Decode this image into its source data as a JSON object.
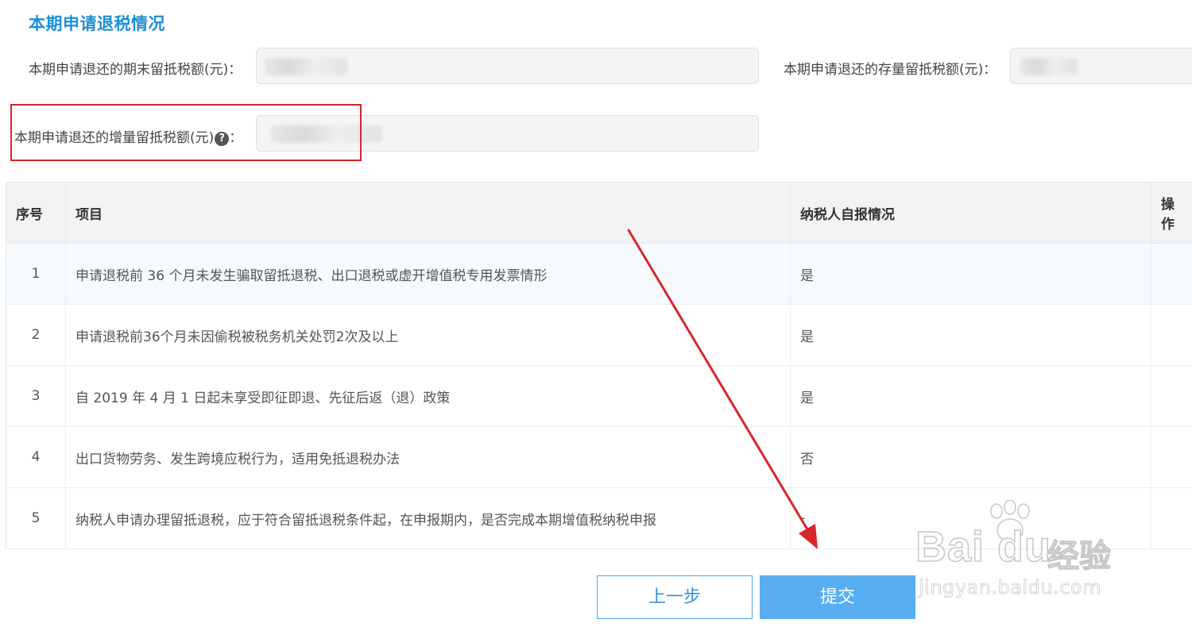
{
  "section": {
    "title": "本期申请退税情况"
  },
  "fields": {
    "period_end_label": "本期申请退还的期末留抵税额(元)：",
    "stock_label": "本期申请退还的存量留抵税额(元)：",
    "increment_label": "本期申请退还的增量留抵税额(元)",
    "increment_colon": "：",
    "help_glyph": "?"
  },
  "table": {
    "headers": {
      "index": "序号",
      "item": "项目",
      "self_report": "纳税人自报情况",
      "action": "操作"
    },
    "rows": [
      {
        "index": "1",
        "item": "申请退税前 36 个月未发生骗取留抵退税、出口退税或虚开增值税专用发票情形",
        "self_report": "是"
      },
      {
        "index": "2",
        "item": "申请退税前36个月未因偷税被税务机关处罚2次及以上",
        "self_report": "是"
      },
      {
        "index": "3",
        "item": "自 2019 年 4 月 1 日起未享受即征即退、先征后返（退）政策",
        "self_report": "是"
      },
      {
        "index": "4",
        "item": "出口货物劳务、发生跨境应税行为，适用免抵退税办法",
        "self_report": "否"
      },
      {
        "index": "5",
        "item": "纳税人申请办理留抵退税，应于符合留抵退税条件起，在申报期内，是否完成本期增值税纳税申报",
        "self_report": "-"
      }
    ]
  },
  "buttons": {
    "prev": "上一步",
    "submit": "提交"
  },
  "watermark": {
    "brand": "Bai du",
    "brand_cn": "经验",
    "url": "jingyan.baidu.com"
  },
  "colors": {
    "accent": "#1e8fd6",
    "highlight": "#d7262b",
    "submit_bg": "#58aef0"
  }
}
